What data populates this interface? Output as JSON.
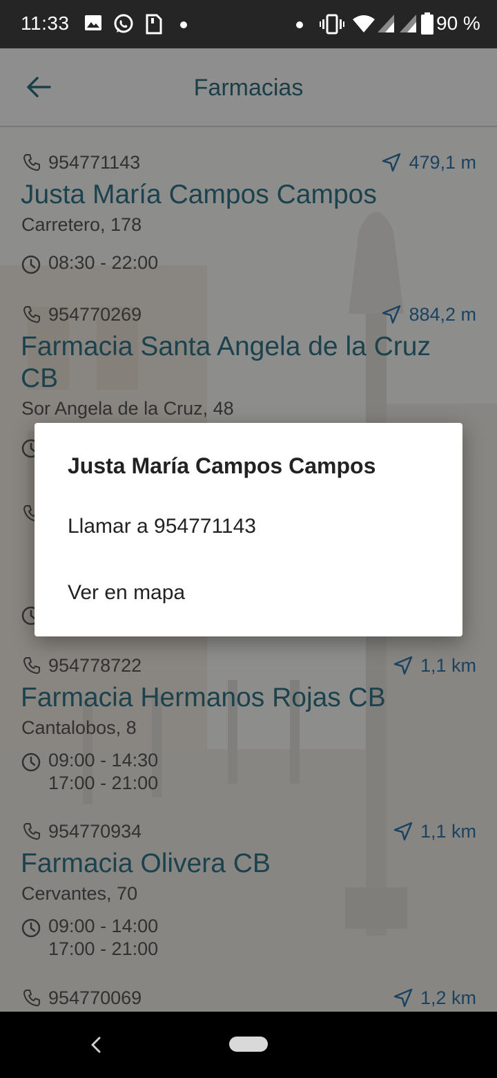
{
  "status_bar": {
    "time": "11:33",
    "battery": "90 %",
    "left_icons": [
      "image-icon",
      "whatsapp-icon",
      "sim-card-icon",
      "dot-icon"
    ],
    "right_icons": [
      "dot-icon",
      "vibrate-icon",
      "wifi-icon",
      "signal-icon",
      "signal-icon",
      "battery-icon"
    ]
  },
  "app_bar": {
    "title": "Farmacias",
    "back_icon": "arrow-back-icon"
  },
  "pharmacies": [
    {
      "phone": "954771143",
      "distance": "479,1 m",
      "name": "Justa María Campos Campos",
      "address": "Carretero, 178",
      "hours": [
        "08:30 - 22:00"
      ]
    },
    {
      "phone": "954770269",
      "distance": "884,2 m",
      "name": "Farmacia Santa Angela de la Cruz CB",
      "address": "Sor Angela de la Cruz, 48",
      "hours": []
    },
    {
      "phone": "954778722",
      "distance": "1,1 km",
      "name": "Farmacia Hermanos Rojas CB",
      "address": "Cantalobos, 8",
      "hours": [
        "09:00 - 14:30",
        "17:00 - 21:00"
      ]
    },
    {
      "phone": "954770934",
      "distance": "1,1 km",
      "name": "Farmacia Olivera CB",
      "address": "Cervantes, 70",
      "hours": [
        "09:00 - 14:00",
        "17:00 - 21:00"
      ]
    },
    {
      "phone": "954770069",
      "distance": "1,2 km",
      "name": "",
      "address": "",
      "hours": []
    }
  ],
  "dialog": {
    "title": "Justa María Campos Campos",
    "options": [
      "Llamar a 954771143",
      "Ver en mapa"
    ]
  },
  "colors": {
    "accent": "#2f7385",
    "distance": "#2f74a8",
    "status_bar": "#252525",
    "nav_bar": "#000000"
  }
}
